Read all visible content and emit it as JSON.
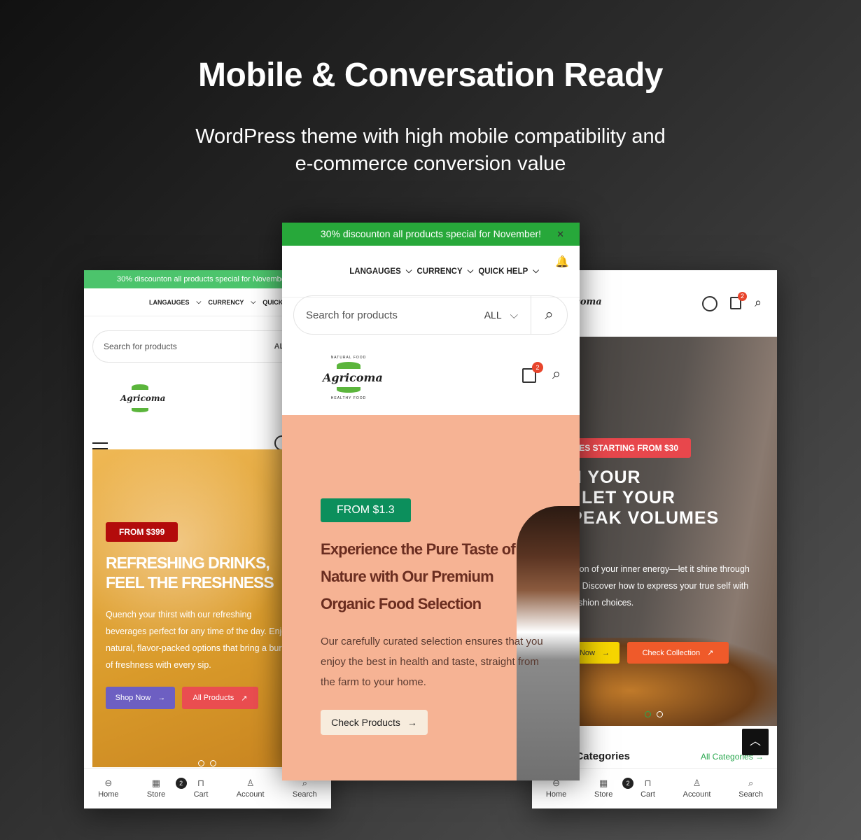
{
  "header": {
    "title": "Mobile & Conversation Ready",
    "subtitle": "WordPress theme with high mobile compatibility and e-commerce conversion value"
  },
  "common": {
    "promo": "30% discounton all products special for November!",
    "languages": "LANGAUGES",
    "currency": "CURRENCY",
    "quick_help": "QUICK HELP",
    "search_placeholder": "Search for products",
    "category": "ALL",
    "logo": "Agricoma",
    "logo_top": "NATURAL FOOD",
    "logo_bottom": "HEALTHY FOOD",
    "cart_count": "2",
    "bottom_nav": [
      {
        "label": "Home",
        "icon": "home-icon"
      },
      {
        "label": "Store",
        "icon": "store-icon"
      },
      {
        "label": "Cart",
        "icon": "cart-icon"
      },
      {
        "label": "Account",
        "icon": "account-icon"
      },
      {
        "label": "Search",
        "icon": "search-icon"
      }
    ]
  },
  "left": {
    "badge": "FROM $399",
    "headline": "REFRESHING DRINKS, FEEL THE FRESHNESS",
    "body": "Quench your thirst with our refreshing beverages perfect for any time of the day. Enjoy natural, flavor-packed options that bring a burst of freshness with every sip.",
    "btn1": "Shop Now",
    "btn2": "All Products",
    "colors": {
      "hero": "#e3a534",
      "badge": "#b30b0b",
      "btn1": "#6d5fc2",
      "btn2": "#ea4d50"
    }
  },
  "center": {
    "badge": "FROM $1.3",
    "headline": "Experience the Pure Taste of Nature with Our Premium Organic Food Selection",
    "body": "Our carefully curated selection ensures that you enjoy the best in health and taste, straight from the farm to your home.",
    "btn": "Check Products",
    "colors": {
      "hero": "#f6b394",
      "badge": "#0c8f5c",
      "headline": "#6a2d20"
    }
  },
  "right": {
    "badge": "PRICES STARTING FROM $30",
    "headline": "UNLEASH YOUR ENERGY: LET YOUR STYLE SPEAK VOLUMES",
    "body": "Your style is a reflection of your inner energy—let it shine through every outfit you wear. Discover how to express your true self with bold and confident fashion choices.",
    "btn1": "Shop Now",
    "btn2": "Check Collection",
    "section": "Categories",
    "section_link": "All Categories",
    "colors": {
      "badge": "#e8474c",
      "btn1": "#f7d600",
      "btn2": "#ef5a2a",
      "link": "#2aa84f"
    }
  }
}
